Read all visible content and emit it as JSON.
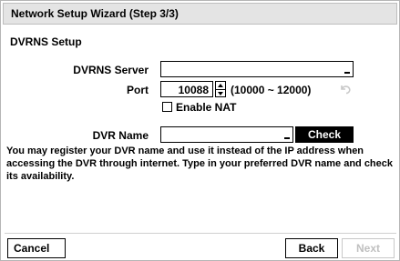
{
  "window": {
    "title": "Network Setup Wizard (Step 3/3)"
  },
  "section": {
    "title": "DVRNS Setup"
  },
  "dvrns_server": {
    "label": "DVRNS Server",
    "value": ""
  },
  "port": {
    "label": "Port",
    "value": "10088",
    "range": "(10000 ~ 12000)",
    "undo_icon": "undo-icon"
  },
  "enable_nat": {
    "label": "Enable NAT",
    "checked": false
  },
  "dvr_name": {
    "label": "DVR Name",
    "value": "",
    "check_label": "Check"
  },
  "description": "You may register your DVR name and use it instead of the IP address when accessing the DVR through internet. Type in your preferred DVR name and check its availability.",
  "footer": {
    "cancel_label": "Cancel",
    "back_label": "Back",
    "next_label": "Next"
  }
}
